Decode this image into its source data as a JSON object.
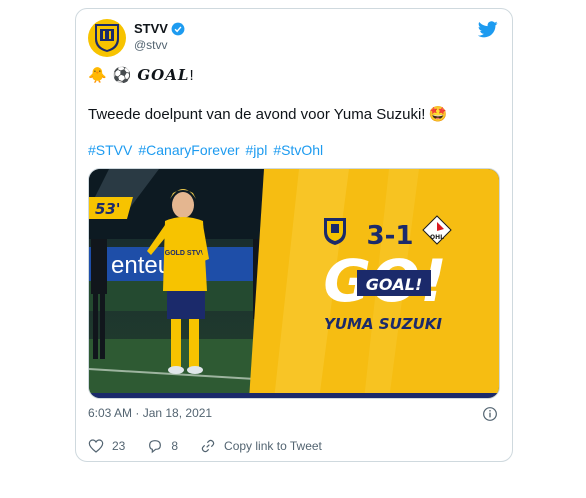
{
  "author": {
    "name": "STVV",
    "handle": "@stvv"
  },
  "tweet": {
    "emoji_chick": "🐥",
    "emoji_ball": "⚽",
    "goal_word": "GOAL",
    "goal_bang": "!",
    "text": "Tweede doelpunt van de avond voor Yuma Suzuki!",
    "emoji_starstruck": "🤩",
    "hashtags": [
      "#STVV",
      "#CanaryForever",
      "#jpl",
      "#StvOhl"
    ]
  },
  "media": {
    "minute": "53'",
    "score": "3-1",
    "board_text": "enteur",
    "shirt_text": "GOLD STVV",
    "badge_stvv": "STVV",
    "badge_ohl": "OHL",
    "big_goal": "GO!",
    "goal_label": "GOAL!",
    "scorer": "YUMA SUZUKI"
  },
  "meta": {
    "timestamp": "6:03 AM · Jan 18, 2021"
  },
  "actions": {
    "likes": "23",
    "replies": "8",
    "copy_link": "Copy link to Tweet"
  },
  "colors": {
    "accent": "#1d9bf0",
    "gold": "#f7c300",
    "navy": "#1b2a6b"
  }
}
